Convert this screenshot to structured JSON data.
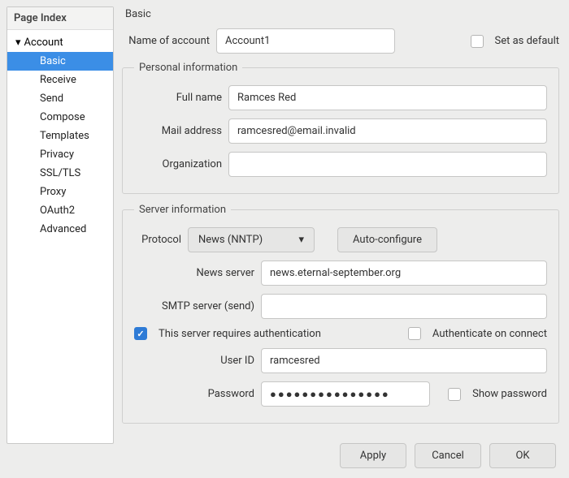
{
  "sidebar": {
    "title": "Page Index",
    "root": "Account",
    "items": [
      "Basic",
      "Receive",
      "Send",
      "Compose",
      "Templates",
      "Privacy",
      "SSL/TLS",
      "Proxy",
      "OAuth2",
      "Advanced"
    ],
    "selected": 0
  },
  "page": {
    "title": "Basic"
  },
  "account": {
    "name_label": "Name of account",
    "name_value": "Account1",
    "set_default_label": "Set as default",
    "set_default_checked": false
  },
  "personal": {
    "legend": "Personal information",
    "full_name_label": "Full name",
    "full_name_value": "Ramces Red",
    "mail_label": "Mail address",
    "mail_value": "ramcesred@email.invalid",
    "org_label": "Organization",
    "org_value": ""
  },
  "server": {
    "legend": "Server information",
    "protocol_label": "Protocol",
    "protocol_value": "News (NNTP)",
    "autoconfigure_label": "Auto-configure",
    "news_server_label": "News server",
    "news_server_value": "news.eternal-september.org",
    "smtp_label": "SMTP server (send)",
    "smtp_value": "",
    "requires_auth_label": "This server requires authentication",
    "requires_auth_checked": true,
    "auth_on_connect_label": "Authenticate on connect",
    "auth_on_connect_checked": false,
    "userid_label": "User ID",
    "userid_value": "ramcesred",
    "password_label": "Password",
    "password_value": "●●●●●●●●●●●●●●●",
    "show_password_label": "Show password",
    "show_password_checked": false
  },
  "buttons": {
    "apply": "Apply",
    "cancel": "Cancel",
    "ok": "OK"
  }
}
